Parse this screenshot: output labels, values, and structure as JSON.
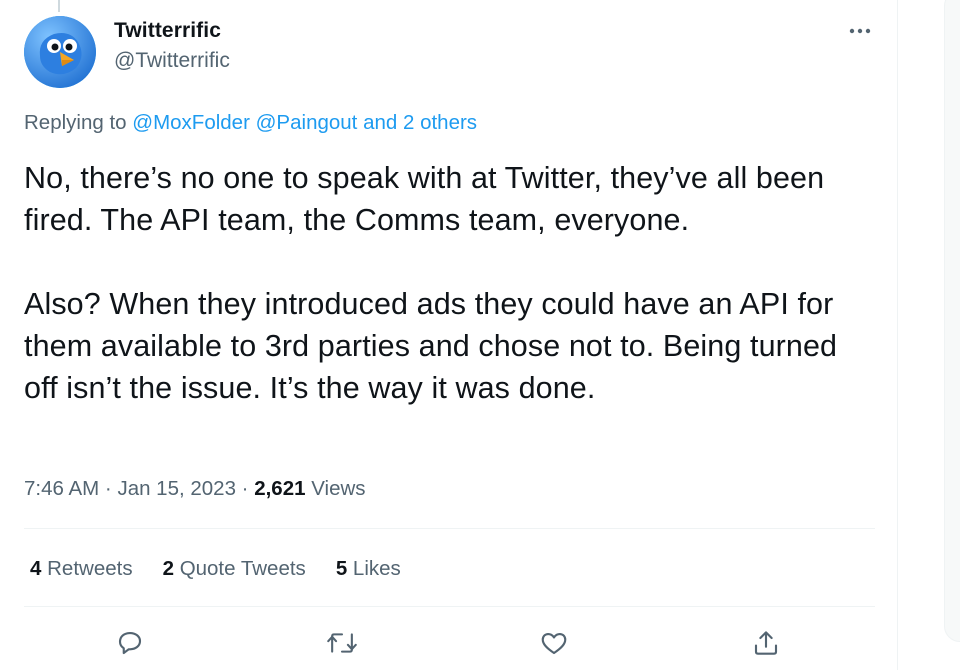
{
  "tweet": {
    "author": {
      "display_name": "Twitterrific",
      "handle": "@Twitterrific",
      "avatar_icon": "twitterrific-bird-logo"
    },
    "replying": {
      "prefix": "Replying to ",
      "mentions": [
        "@MoxFolder",
        "@Paingout"
      ],
      "connector": " and ",
      "others": "2 others"
    },
    "text": {
      "paragraph1": "No, there’s no one to speak with at Twitter, they’ve all been fired. The API team, the Comms team, everyone.",
      "paragraph2": "Also? When they introduced ads they could have an API for them available to 3rd parties and chose not to. Being turned off isn’t the issue. It’s the way it was done."
    },
    "meta": {
      "time": "7:46 AM",
      "date": "Jan 15, 2023",
      "separator": " · ",
      "views_count": "2,621",
      "views_label": "Views"
    },
    "stats": {
      "retweets_count": "4",
      "retweets_label": "Retweets",
      "quotes_count": "2",
      "quotes_label": "Quote Tweets",
      "likes_count": "5",
      "likes_label": "Likes"
    },
    "actions": [
      "reply-icon",
      "retweet-icon",
      "like-icon",
      "share-icon"
    ]
  },
  "colors": {
    "accent": "#1d9bf0",
    "text_primary": "#0f1419",
    "text_secondary": "#536471",
    "divider": "#eff3f4"
  }
}
